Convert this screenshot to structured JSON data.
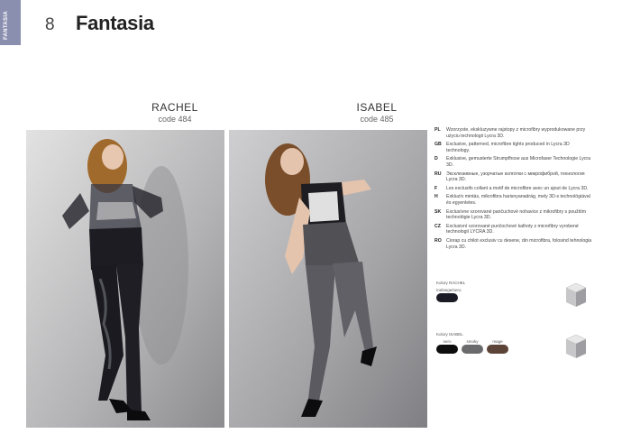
{
  "header": {
    "side_tab": "FANTASIA",
    "page_number": "8",
    "title": "Fantasia"
  },
  "models": [
    {
      "name": "RACHEL",
      "code": "code 484"
    },
    {
      "name": "ISABEL",
      "code": "code 485"
    }
  ],
  "descriptions": [
    {
      "lang": "PL",
      "text": "Wzorzyste, ekskluzywne rajstopy z microfibry wyprodukowane przy użyciu technologii Lycra 3D."
    },
    {
      "lang": "GB",
      "text": "Exclusive, patterned, microfibre tights produced in Lycra 3D technology."
    },
    {
      "lang": "D",
      "text": "Exklusive, gemusterte Strumpfhose aus Microfaser Technologie Lycra 3D."
    },
    {
      "lang": "RU",
      "text": "Эксклюзивные, узорчатые колготки с микрофиброй, технология Lycra 3D."
    },
    {
      "lang": "F",
      "text": "Les exclusifs collant a motif de microfibre avec un ajout de Lycra 3D."
    },
    {
      "lang": "H",
      "text": "Exkluzív mintás, mikrofibra harisnyanadrág, mely 3D-s technológiával és egyenletes."
    },
    {
      "lang": "SK",
      "text": "Exclusívne vzorované pančuchové nohavice z mikrofibry s použitím technológie Lycra 3D."
    },
    {
      "lang": "CZ",
      "text": "Exclusivní vzorované punčochové kalhoty z microfibry vyrobené technologií LYCRA 3D."
    },
    {
      "lang": "RO",
      "text": "Ciorap cu chilot exclusiv cu desene, din microfibra, folosind tehnologia Lycra 3D."
    }
  ],
  "swatches": [
    {
      "caption": "Kolory RACHEL",
      "colors": [
        {
          "name": "melange/nero",
          "hex": "#1b1b25"
        }
      ]
    },
    {
      "caption": "Kolory ISABEL",
      "colors": [
        {
          "name": "nero",
          "hex": "#0d0d0d"
        },
        {
          "name": "smoky",
          "hex": "#6a6a6c"
        },
        {
          "name": "mage",
          "hex": "#5b4337"
        }
      ]
    }
  ],
  "colors": {
    "side_tab": "#8a8fb0",
    "photo_bg": "#a9a9ab"
  }
}
